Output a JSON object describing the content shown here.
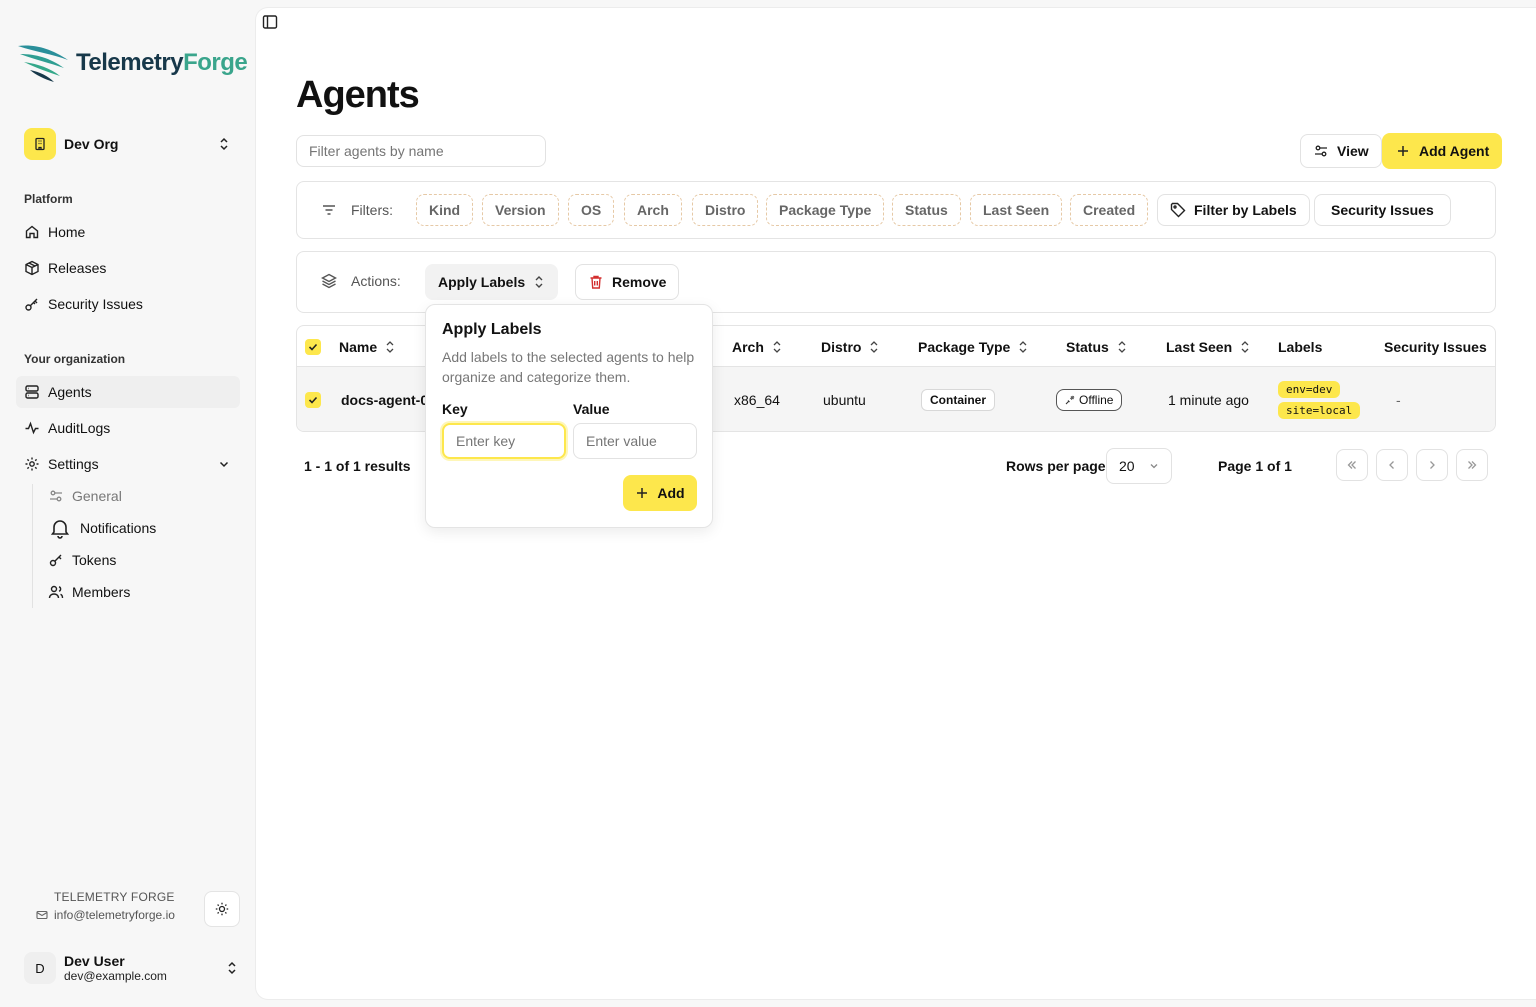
{
  "brand": {
    "name_part1": "Telemetry",
    "name_part2": "Forge"
  },
  "org": {
    "name": "Dev Org"
  },
  "sidebar": {
    "platform_title": "Platform",
    "platform_items": [
      {
        "label": "Home",
        "icon": "home-icon"
      },
      {
        "label": "Releases",
        "icon": "package-icon"
      },
      {
        "label": "Security Issues",
        "icon": "key-icon"
      }
    ],
    "org_title": "Your organization",
    "org_items": [
      {
        "label": "Agents",
        "icon": "agents-icon",
        "active": true
      },
      {
        "label": "AuditLogs",
        "icon": "activity-icon"
      },
      {
        "label": "Settings",
        "icon": "gear-icon"
      }
    ],
    "settings_items": [
      {
        "label": "General",
        "icon": "sliders-icon"
      },
      {
        "label": "Notifications",
        "icon": "bell-icon"
      },
      {
        "label": "Tokens",
        "icon": "key-icon"
      },
      {
        "label": "Members",
        "icon": "users-icon"
      }
    ],
    "footer_brand": "TELEMETRY FORGE",
    "footer_email": "info@telemetryforge.io",
    "user": {
      "initial": "D",
      "name": "Dev User",
      "email": "dev@example.com"
    }
  },
  "page": {
    "title": "Agents",
    "filter_placeholder": "Filter agents by name",
    "view_label": "View",
    "add_agent_label": "Add Agent"
  },
  "filters": {
    "label": "Filters:",
    "chips": [
      "Kind",
      "Version",
      "OS",
      "Arch",
      "Distro",
      "Package Type",
      "Status",
      "Last Seen",
      "Created"
    ],
    "filter_by_labels": "Filter by Labels",
    "security_issues": "Security Issues"
  },
  "actions": {
    "label": "Actions:",
    "apply_labels": "Apply Labels",
    "remove": "Remove"
  },
  "table": {
    "columns": [
      "Name",
      "Arch",
      "Distro",
      "Package Type",
      "Status",
      "Last Seen",
      "Labels",
      "Security Issues"
    ],
    "rows": [
      {
        "name": "docs-agent-0",
        "arch": "x86_64",
        "distro": "ubuntu",
        "package_type": "Container",
        "status": "Offline",
        "last_seen": "1 minute ago",
        "labels": [
          "env=dev",
          "site=local"
        ],
        "security_issues": "-"
      }
    ]
  },
  "pagination": {
    "results": "1 - 1 of 1 results",
    "rows_per_page_label": "Rows per page",
    "rows_per_page": "20",
    "page_label": "Page 1 of 1"
  },
  "popover": {
    "title": "Apply Labels",
    "description": "Add labels to the selected agents to help organize and categorize them.",
    "key_label": "Key",
    "value_label": "Value",
    "key_placeholder": "Enter key",
    "value_placeholder": "Enter value",
    "add_label": "Add"
  },
  "colors": {
    "accent": "#fde74c",
    "brand_dark": "#17384a",
    "brand_green": "#3aa58c"
  }
}
